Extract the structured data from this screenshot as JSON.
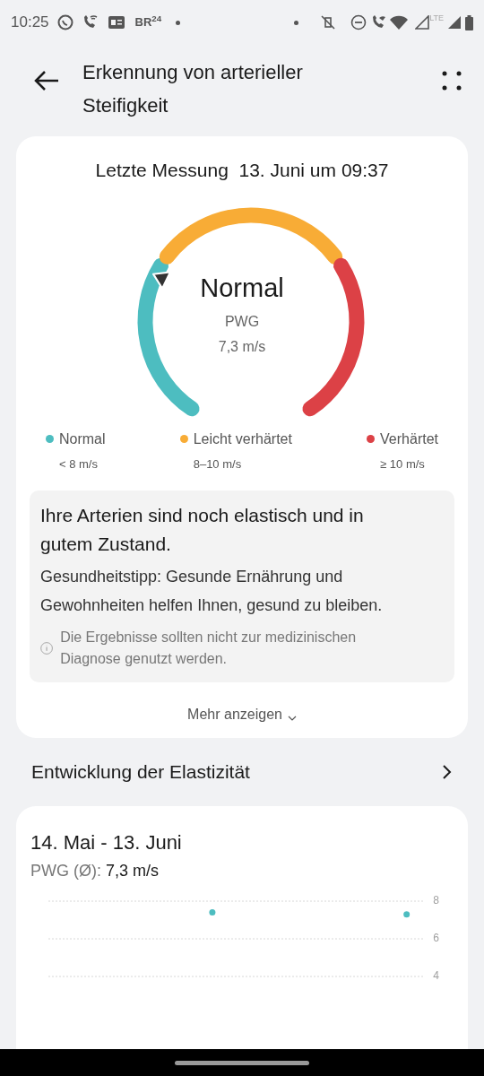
{
  "status_bar": {
    "time": "10:25",
    "brand_mark": "BR$^{24}$",
    "network": "LTE"
  },
  "header": {
    "title": "Erkennung von arterieller Steifigkeit"
  },
  "measurement": {
    "label": "Letzte Messung",
    "date": "13. Juni um 09:37",
    "gauge": {
      "status": "Normal",
      "metric": "PWG",
      "reading": "7,3 m/s",
      "segments": [
        {
          "color": "#4dbdc0"
        },
        {
          "color": "#f8ac36"
        },
        {
          "color": "#dc4146"
        }
      ]
    },
    "legend": [
      {
        "label": "Normal",
        "range": "< 8 m/s",
        "color": "#4dbdc0"
      },
      {
        "label": "Leicht verhärtet",
        "range": "8–10 m/s",
        "color": "#f8ac36"
      },
      {
        "label": "Verhärtet",
        "range": "≥ 10 m/s",
        "color": "#dc4146"
      }
    ],
    "summary": "Ihre Arterien sind noch elastisch und in gutem Zustand.",
    "tip": "Gesundheitstipp: Gesunde Ernährung und Gewohnheiten helfen Ihnen, gesund zu bleiben.",
    "disclaimer": "Die Ergebnisse sollten nicht zur medizinischen Diagnose genutzt werden.",
    "more": "Mehr anzeigen"
  },
  "trend": {
    "title": "Entwicklung der Elastizität",
    "range": "14. Mai - 13. Juni",
    "average_label": "PWG (Ø):",
    "average_value": "7,3 m/s",
    "chart_data": {
      "type": "scatter",
      "categories": [
        null,
        null,
        null,
        null,
        null,
        null,
        null,
        null,
        null,
        null,
        null,
        null,
        null,
        null,
        null,
        null,
        null,
        null,
        null,
        null,
        null,
        null,
        null,
        null,
        null,
        null,
        null,
        null,
        null,
        null,
        null
      ],
      "series": [
        {
          "color": "#4dbdc0",
          "values": [
            null,
            null,
            null,
            null,
            null,
            null,
            null,
            null,
            null,
            null,
            null,
            null,
            null,
            7.4,
            null,
            null,
            null,
            null,
            null,
            null,
            null,
            null,
            null,
            null,
            null,
            null,
            null,
            null,
            null,
            7.3,
            null
          ]
        }
      ],
      "ylim": [
        4,
        8
      ],
      "yticks": [
        4,
        6,
        8
      ],
      "grid": true
    }
  }
}
